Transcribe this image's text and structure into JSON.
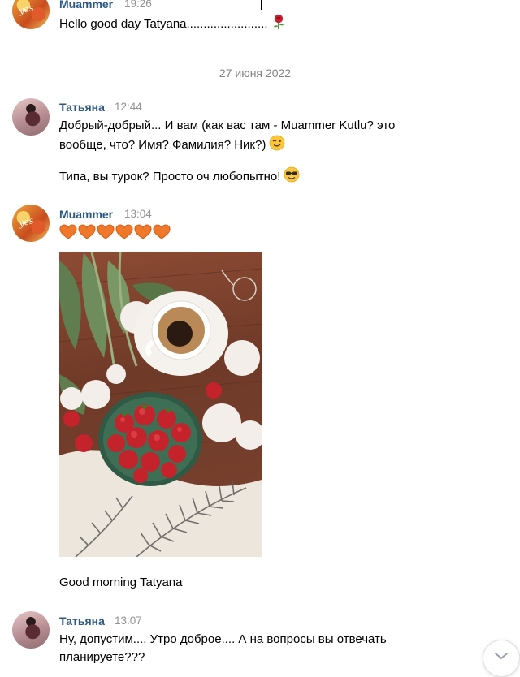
{
  "messages": [
    {
      "sender": "Muammer",
      "time": "19:26",
      "lines": [
        "Hello good day Tatyana........................"
      ],
      "emoji": "rose-icon"
    },
    {
      "sender": "Татьяна",
      "time": "12:44",
      "lines": [
        "Добрый-добрый... И вам (как вас там - Muammer Kutlu? это",
        "вообще, что? Имя? Фамилия? Ник?)",
        "Типа, вы турок? Просто оч любопытно!"
      ],
      "emoji": [
        "winking-face-icon",
        "nerd-face-icon"
      ]
    },
    {
      "sender": "Muammer",
      "time": "13:04",
      "hearts": 6,
      "caption": "Good morning Tatyana",
      "photo": "coffee-strawberries-peonies-photo"
    },
    {
      "sender": "Татьяна",
      "time": "13:07",
      "lines": [
        "Ну, допустим.... Утро доброе.... А на вопросы вы отвечать",
        "планируете???"
      ]
    }
  ],
  "date_separator": "27 июня 2022",
  "scroll_button": "chevron-down-icon",
  "colors": {
    "name": "#2a5885",
    "time": "#939393",
    "date": "#828282",
    "heart": "#f0782a"
  }
}
